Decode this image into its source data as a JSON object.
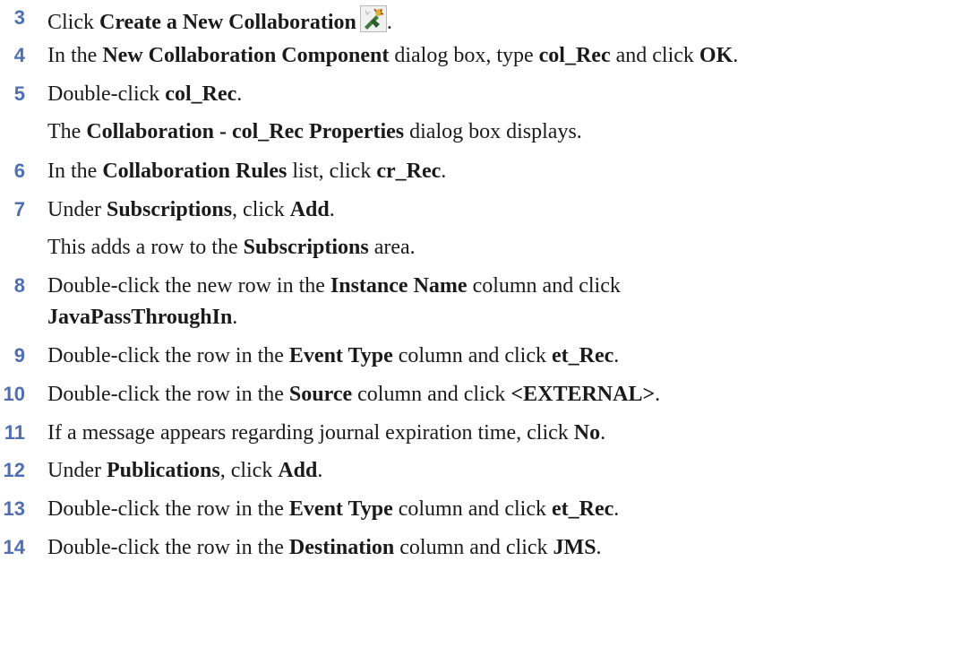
{
  "steps": [
    {
      "num": "3",
      "parts": [
        {
          "t": "Click "
        },
        {
          "t": "Create a New Collaboration",
          "b": true
        },
        {
          "icon": "create-collaboration-icon"
        },
        {
          "t": "."
        }
      ]
    },
    {
      "num": "4",
      "parts": [
        {
          "t": "In the "
        },
        {
          "t": "New Collaboration Component",
          "b": true
        },
        {
          "t": " dialog box, type "
        },
        {
          "t": "col_Rec",
          "b": true
        },
        {
          "t": " and click "
        },
        {
          "t": "OK",
          "b": true
        },
        {
          "t": "."
        }
      ]
    },
    {
      "num": "5",
      "parts": [
        {
          "t": "Double-click "
        },
        {
          "t": "col_Rec",
          "b": true
        },
        {
          "t": "."
        }
      ]
    },
    {
      "note": true,
      "parts": [
        {
          "t": "The "
        },
        {
          "t": "Collaboration - col_Rec Properties",
          "b": true
        },
        {
          "t": " dialog box displays."
        }
      ]
    },
    {
      "num": "6",
      "parts": [
        {
          "t": "In the "
        },
        {
          "t": "Collaboration Rules",
          "b": true
        },
        {
          "t": " list, click "
        },
        {
          "t": "cr_Rec",
          "b": true
        },
        {
          "t": "."
        }
      ]
    },
    {
      "num": "7",
      "parts": [
        {
          "t": "Under "
        },
        {
          "t": "Subscriptions",
          "b": true
        },
        {
          "t": ", click "
        },
        {
          "t": "Add",
          "b": true
        },
        {
          "t": "."
        }
      ]
    },
    {
      "note": true,
      "parts": [
        {
          "t": "This adds a row to the "
        },
        {
          "t": "Subscriptions",
          "b": true
        },
        {
          "t": " area."
        }
      ]
    },
    {
      "num": "8",
      "parts": [
        {
          "t": "Double-click the new row in the "
        },
        {
          "t": "Instance Name",
          "b": true
        },
        {
          "t": " column and click"
        }
      ]
    },
    {
      "cont": true,
      "parts": [
        {
          "t": "JavaPassThroughIn",
          "b": true
        },
        {
          "t": "."
        }
      ]
    },
    {
      "num": "9",
      "parts": [
        {
          "t": "Double-click the row in the "
        },
        {
          "t": "Event Type",
          "b": true
        },
        {
          "t": " column and click "
        },
        {
          "t": "et_Rec",
          "b": true
        },
        {
          "t": "."
        }
      ]
    },
    {
      "num": "10",
      "parts": [
        {
          "t": "Double-click the row in the "
        },
        {
          "t": "Source",
          "b": true
        },
        {
          "t": " column and click "
        },
        {
          "t": "<EXTERNAL>",
          "b": true
        },
        {
          "t": "."
        }
      ]
    },
    {
      "num": "11",
      "parts": [
        {
          "t": "If a message appears regarding journal expiration time, click "
        },
        {
          "t": "No",
          "b": true
        },
        {
          "t": "."
        }
      ]
    },
    {
      "num": "12",
      "parts": [
        {
          "t": "Under "
        },
        {
          "t": "Publications",
          "b": true
        },
        {
          "t": ", click "
        },
        {
          "t": "Add",
          "b": true
        },
        {
          "t": "."
        }
      ]
    },
    {
      "num": "13",
      "parts": [
        {
          "t": "Double-click the row in the "
        },
        {
          "t": "Event Type",
          "b": true
        },
        {
          "t": " column and click "
        },
        {
          "t": "et_Rec",
          "b": true
        },
        {
          "t": "."
        }
      ]
    },
    {
      "num": "14",
      "parts": [
        {
          "t": "Double-click the row in the "
        },
        {
          "t": "Destination",
          "b": true
        },
        {
          "t": " column and click "
        },
        {
          "t": "JMS",
          "b": true
        },
        {
          "t": "."
        }
      ]
    }
  ],
  "colors": {
    "step_number": "#4f6fb3",
    "text": "#1a1a1a",
    "background": "#ffffff"
  }
}
